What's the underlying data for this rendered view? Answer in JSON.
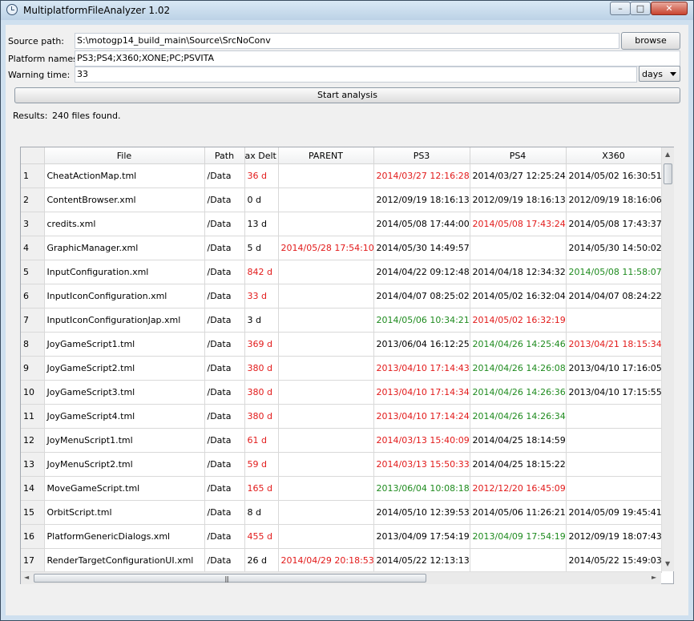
{
  "window": {
    "title": "MultiplatformFileAnalyzer 1.02",
    "minimize": "–",
    "maximize": "□",
    "close": "✕"
  },
  "form": {
    "source_label": "Source path:",
    "source_value": "S:\\motogp14_build_main\\Source\\SrcNoConv",
    "browse_label": "browse",
    "platform_label": "Platform names:",
    "platform_value": "PS3;PS4;X360;XONE;PC;PSVITA",
    "warning_label": "Warning time:",
    "warning_value": "33",
    "unit_value": "days",
    "start_label": "Start analysis",
    "results_label": "Results:",
    "results_value": "240 files found."
  },
  "table": {
    "columns": [
      "File",
      "Path",
      "ax Delt",
      "PARENT",
      "PS3",
      "PS4",
      "X360"
    ],
    "rows": [
      {
        "n": "1",
        "file": "CheatActionMap.tml",
        "path": "/Data",
        "delta": "36 d",
        "dc": "red",
        "parent": "",
        "ps3": "2014/03/27 12:16:28",
        "ps3c": "red",
        "ps4": "2014/03/27 12:25:24",
        "ps4c": "",
        "x360": "2014/05/02 16:30:51",
        "x360c": ""
      },
      {
        "n": "2",
        "file": "ContentBrowser.xml",
        "path": "/Data",
        "delta": "0 d",
        "dc": "",
        "parent": "",
        "ps3": "2012/09/19 18:16:13",
        "ps3c": "",
        "ps4": "2012/09/19 18:16:13",
        "ps4c": "",
        "x360": "2012/09/19 18:16:06",
        "x360c": ""
      },
      {
        "n": "3",
        "file": "credits.xml",
        "path": "/Data",
        "delta": "13 d",
        "dc": "",
        "parent": "",
        "ps3": "2014/05/08 17:44:00",
        "ps3c": "",
        "ps4": "2014/05/08 17:43:24",
        "ps4c": "red",
        "x360": "2014/05/08 17:43:37",
        "x360c": ""
      },
      {
        "n": "4",
        "file": "GraphicManager.xml",
        "path": "/Data",
        "delta": "5 d",
        "dc": "",
        "parent": "2014/05/28 17:54:10",
        "ps3": "2014/05/30 14:49:57",
        "ps3c": "",
        "ps4": "",
        "ps4c": "",
        "x360": "2014/05/30 14:50:02",
        "x360c": ""
      },
      {
        "n": "5",
        "file": "InputConfiguration.xml",
        "path": "/Data",
        "delta": "842 d",
        "dc": "red",
        "parent": "",
        "ps3": "2014/04/22 09:12:48",
        "ps3c": "",
        "ps4": "2014/04/18 12:34:32",
        "ps4c": "",
        "x360": "2014/05/08 11:58:07",
        "x360c": "green"
      },
      {
        "n": "6",
        "file": "InputIconConfiguration.xml",
        "path": "/Data",
        "delta": "33 d",
        "dc": "red",
        "parent": "",
        "ps3": "2014/04/07 08:25:02",
        "ps3c": "",
        "ps4": "2014/05/02 16:32:04",
        "ps4c": "",
        "x360": "2014/04/07 08:24:22",
        "x360c": ""
      },
      {
        "n": "7",
        "file": "InputIconConfigurationJap.xml",
        "path": "/Data",
        "delta": "3 d",
        "dc": "",
        "parent": "",
        "ps3": "2014/05/06 10:34:21",
        "ps3c": "green",
        "ps4": "2014/05/02 16:32:19",
        "ps4c": "red",
        "x360": "",
        "x360c": ""
      },
      {
        "n": "8",
        "file": "JoyGameScript1.tml",
        "path": "/Data",
        "delta": "369 d",
        "dc": "red",
        "parent": "",
        "ps3": "2013/06/04 16:12:25",
        "ps3c": "",
        "ps4": "2014/04/26 14:25:46",
        "ps4c": "green",
        "x360": "2013/04/21 18:15:34",
        "x360c": "red"
      },
      {
        "n": "9",
        "file": "JoyGameScript2.tml",
        "path": "/Data",
        "delta": "380 d",
        "dc": "red",
        "parent": "",
        "ps3": "2013/04/10 17:14:43",
        "ps3c": "red",
        "ps4": "2014/04/26 14:26:08",
        "ps4c": "green",
        "x360": "2013/04/10 17:16:05",
        "x360c": ""
      },
      {
        "n": "10",
        "file": "JoyGameScript3.tml",
        "path": "/Data",
        "delta": "380 d",
        "dc": "red",
        "parent": "",
        "ps3": "2013/04/10 17:14:34",
        "ps3c": "red",
        "ps4": "2014/04/26 14:26:36",
        "ps4c": "green",
        "x360": "2013/04/10 17:15:55",
        "x360c": ""
      },
      {
        "n": "11",
        "file": "JoyGameScript4.tml",
        "path": "/Data",
        "delta": "380 d",
        "dc": "red",
        "parent": "",
        "ps3": "2013/04/10 17:14:24",
        "ps3c": "red",
        "ps4": "2014/04/26 14:26:34",
        "ps4c": "green",
        "x360": "",
        "x360c": ""
      },
      {
        "n": "12",
        "file": "JoyMenuScript1.tml",
        "path": "/Data",
        "delta": "61 d",
        "dc": "red",
        "parent": "",
        "ps3": "2014/03/13 15:40:09",
        "ps3c": "red",
        "ps4": "2014/04/25 18:14:59",
        "ps4c": "",
        "x360": "",
        "x360c": ""
      },
      {
        "n": "13",
        "file": "JoyMenuScript2.tml",
        "path": "/Data",
        "delta": "59 d",
        "dc": "red",
        "parent": "",
        "ps3": "2014/03/13 15:50:33",
        "ps3c": "red",
        "ps4": "2014/04/25 18:15:22",
        "ps4c": "",
        "x360": "",
        "x360c": ""
      },
      {
        "n": "14",
        "file": "MoveGameScript.tml",
        "path": "/Data",
        "delta": "165 d",
        "dc": "red",
        "parent": "",
        "ps3": "2013/06/04 10:08:18",
        "ps3c": "green",
        "ps4": "2012/12/20 16:45:09",
        "ps4c": "red",
        "x360": "",
        "x360c": ""
      },
      {
        "n": "15",
        "file": "OrbitScript.tml",
        "path": "/Data",
        "delta": "8 d",
        "dc": "",
        "parent": "",
        "ps3": "2014/05/10 12:39:53",
        "ps3c": "",
        "ps4": "2014/05/06 11:26:21",
        "ps4c": "",
        "x360": "2014/05/09 19:45:41",
        "x360c": ""
      },
      {
        "n": "16",
        "file": "PlatformGenericDialogs.xml",
        "path": "/Data",
        "delta": "455 d",
        "dc": "red",
        "parent": "",
        "ps3": "2013/04/09 17:54:19",
        "ps3c": "",
        "ps4": "2013/04/09 17:54:19",
        "ps4c": "green",
        "x360": "2012/09/19 18:07:43",
        "x360c": ""
      },
      {
        "n": "17",
        "file": "RenderTargetConfigurationUI.xml",
        "path": "/Data",
        "delta": "26 d",
        "dc": "",
        "parent": "2014/04/29 20:18:53",
        "ps3": "2014/05/22 12:13:13",
        "ps3c": "",
        "ps4": "",
        "ps4c": "",
        "x360": "2014/05/22 15:49:03",
        "x360c": ""
      }
    ]
  },
  "scrollbars": {
    "up": "▲",
    "down": "▼",
    "left": "◄",
    "right": "►",
    "grip": "|||"
  }
}
